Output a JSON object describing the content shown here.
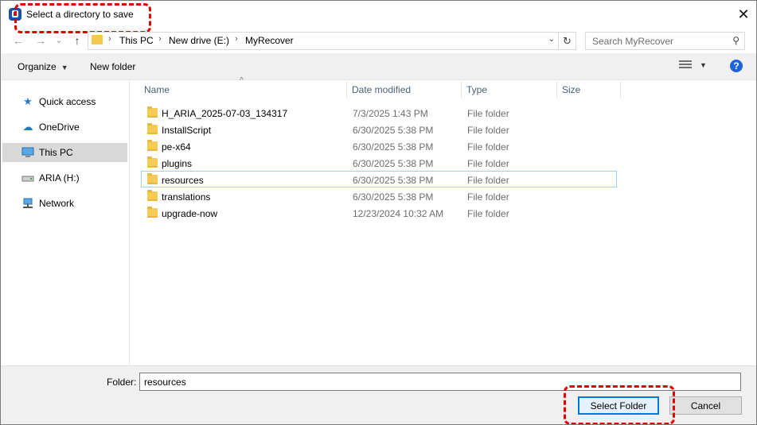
{
  "window": {
    "title": "Select a directory to save",
    "close_glyph": "✕"
  },
  "nav": {
    "back_glyph": "←",
    "forward_glyph": "→",
    "recent_glyph": "⌄",
    "up_glyph": "↑",
    "breadcrumbs": [
      "This PC",
      "New drive (E:)",
      "MyRecover"
    ],
    "refresh_glyph": "↻",
    "search_placeholder": "Search MyRecover"
  },
  "toolbar": {
    "organize_label": "Organize",
    "new_folder_label": "New folder",
    "help_label": "?"
  },
  "sidebar": {
    "items": [
      {
        "label": "Quick access",
        "icon": "star-icon"
      },
      {
        "label": "OneDrive",
        "icon": "cloud-icon"
      },
      {
        "label": "This PC",
        "icon": "computer-icon"
      },
      {
        "label": "ARIA (H:)",
        "icon": "drive-icon"
      },
      {
        "label": "Network",
        "icon": "network-icon"
      }
    ]
  },
  "file_list": {
    "columns": [
      "Name",
      "Date modified",
      "Type",
      "Size"
    ],
    "rows": [
      {
        "name": "H_ARIA_2025-07-03_134317",
        "date": "7/3/2025 1:43 PM",
        "type": "File folder"
      },
      {
        "name": "InstallScript",
        "date": "6/30/2025 5:38 PM",
        "type": "File folder"
      },
      {
        "name": "pe-x64",
        "date": "6/30/2025 5:38 PM",
        "type": "File folder"
      },
      {
        "name": "plugins",
        "date": "6/30/2025 5:38 PM",
        "type": "File folder"
      },
      {
        "name": "resources",
        "date": "6/30/2025 5:38 PM",
        "type": "File folder"
      },
      {
        "name": "translations",
        "date": "6/30/2025 5:38 PM",
        "type": "File folder"
      },
      {
        "name": "upgrade-now",
        "date": "12/23/2024 10:32 AM",
        "type": "File folder"
      }
    ]
  },
  "bottom": {
    "folder_label": "Folder:",
    "folder_value": "resources",
    "select_button": "Select Folder",
    "cancel_button": "Cancel"
  },
  "colors": {
    "accent": "#0078d7",
    "annotation": "#e00000",
    "folder": "#f5cb55"
  }
}
